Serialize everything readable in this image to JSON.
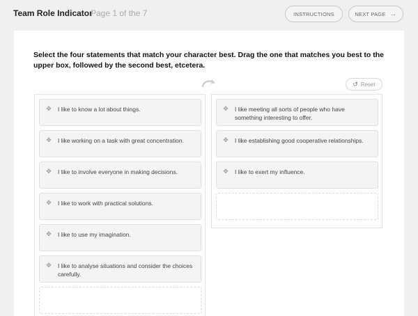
{
  "header": {
    "title": "Team Role Indicator",
    "page_info": "Page 1 of the 7",
    "instructions_label": "INSTRUCTIONS",
    "next_label": "NEXT PAGE"
  },
  "task": {
    "instruction": "Select the four statements that match your character best. Drag the one that matches you best to the upper box, followed by the second best, etcetera.",
    "reset_label": "Reset"
  },
  "left_list": [
    "I like to know a lot about things.",
    "I like working on a task with great concentration.",
    "I like to involve everyone in making decisions.",
    "I like to work with practical solutions.",
    "I like to use my imagination.",
    "I like to analyse situations and consider the choices carefully."
  ],
  "right_list": [
    "I like meeting all sorts of people who have something interesting to offer.",
    "I like establishing good cooperative relationships.",
    "I like to exert my influence."
  ],
  "icons": {
    "drag": "drag-handle-icon",
    "swap": "curved-arrow-icon",
    "reset": "undo-icon",
    "next": "arrow-right-icon"
  }
}
